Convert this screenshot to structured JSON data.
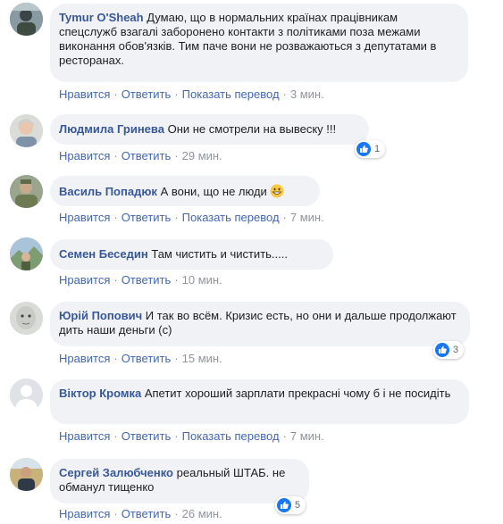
{
  "actions": {
    "like": "Нравится",
    "reply": "Ответить",
    "translate": "Показать перевод",
    "separator": "·"
  },
  "comments": [
    {
      "author": "Tymur O'Sheah",
      "text": "Думаю, що в нормальних країнах працівникам спецслужб взагалі заборонено контакти з політиками поза межами виконання обов'язків. Тим паче вони не розважаються з депутатами в ресторанах.",
      "time": "3 мин."
    },
    {
      "author": "Людмила Гринева",
      "text": "Они не смотрели на вывеску !!!",
      "time": "29 мин.",
      "reactions": "1"
    },
    {
      "author": "Василь Попадюк",
      "text": "А вони, що не люди",
      "time": "7 мин."
    },
    {
      "author": "Семен Беседин",
      "text": "Там чистить и чистить.....",
      "time": "10 мин."
    },
    {
      "author": "Юрій Попович",
      "text": "И так во всём. Кризис есть, но они и дальше продолжают   дить наши деньги (с)",
      "time": "15 мин.",
      "reactions": "3"
    },
    {
      "author": "Віктор Кромка",
      "text": "Апетит хороший зарплати прекрасні чому б і не посидіть",
      "time": "7 мин."
    },
    {
      "author": "Сергей Залюбченко",
      "text": "реальный ШТАБ. не обманул тищенко",
      "time": "26 мин.",
      "reactions": "5"
    }
  ],
  "colors": {
    "author": "#385898",
    "link": "#4267b2",
    "meta": "#90949c",
    "bubble": "#f0f2f5",
    "like_blue": "#1877f2"
  }
}
